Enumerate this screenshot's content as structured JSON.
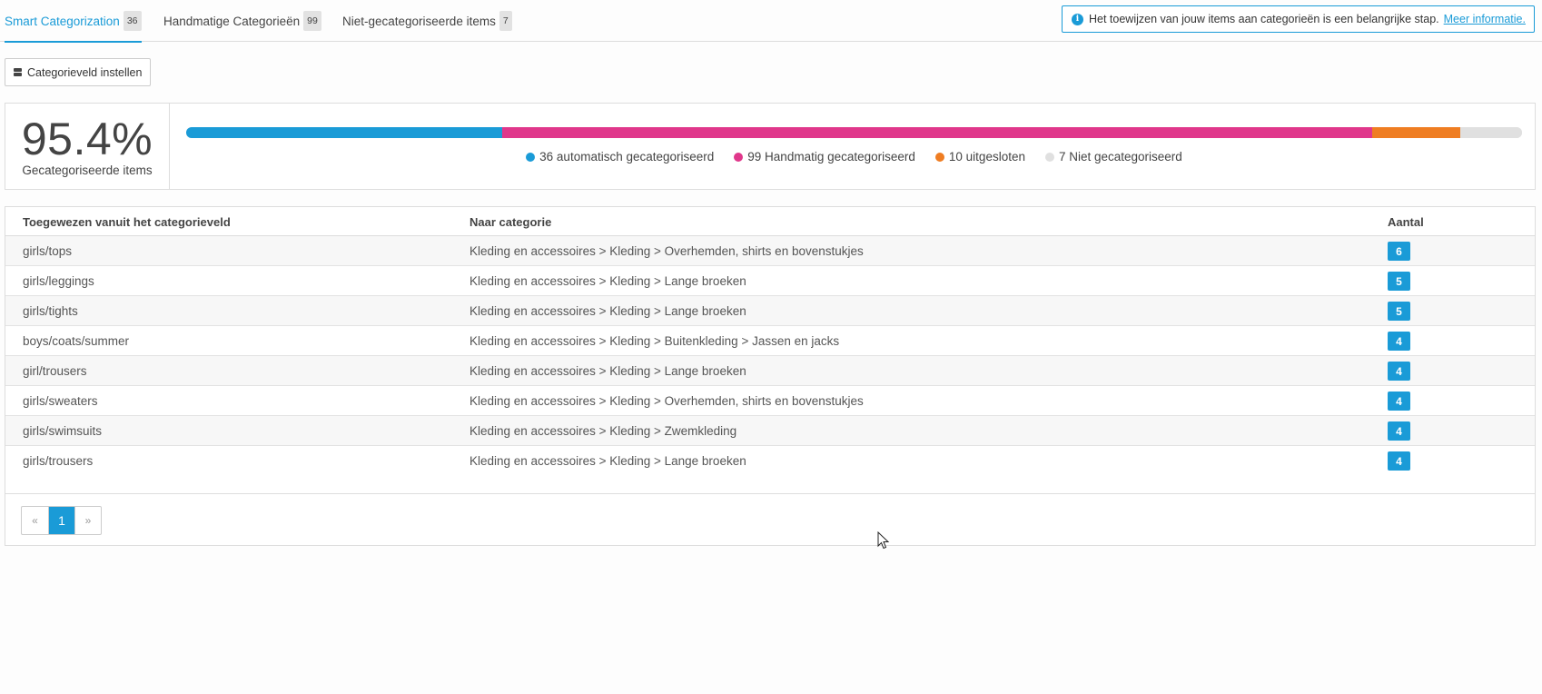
{
  "tabs": [
    {
      "label": "Smart Categorization",
      "count": "36",
      "active": true
    },
    {
      "label": "Handmatige Categorieën",
      "count": "99",
      "active": false
    },
    {
      "label": "Niet-gecategoriseerde items",
      "count": "7",
      "active": false
    }
  ],
  "info": {
    "text": "Het toewijzen van jouw items aan categorieën is een belangrijke stap.",
    "link": "Meer informatie."
  },
  "setup_button": {
    "label": "Categorieveld instellen",
    "icon": "list-icon"
  },
  "stats": {
    "percentage": "95.4%",
    "label": "Gecategoriseerde items",
    "segments": [
      {
        "legend": "36 automatisch gecategoriseerd",
        "value": 36,
        "color": "#1a9bd7"
      },
      {
        "legend": "99 Handmatig gecategoriseerd",
        "value": 99,
        "color": "#e0378b"
      },
      {
        "legend": "10 uitgesloten",
        "value": 10,
        "color": "#ef7d22"
      },
      {
        "legend": "7 Niet gecategoriseerd",
        "value": 7,
        "color": "#e0e0e0"
      }
    ]
  },
  "table": {
    "headers": {
      "field": "Toegewezen vanuit het categorieveld",
      "category": "Naar categorie",
      "count": "Aantal"
    },
    "rows": [
      {
        "field": "girls/tops",
        "category": "Kleding en accessoires > Kleding > Overhemden, shirts en bovenstukjes",
        "count": "6"
      },
      {
        "field": "girls/leggings",
        "category": "Kleding en accessoires > Kleding > Lange broeken",
        "count": "5"
      },
      {
        "field": "girls/tights",
        "category": "Kleding en accessoires > Kleding > Lange broeken",
        "count": "5"
      },
      {
        "field": "boys/coats/summer",
        "category": "Kleding en accessoires > Kleding > Buitenkleding > Jassen en jacks",
        "count": "4"
      },
      {
        "field": "girl/trousers",
        "category": "Kleding en accessoires > Kleding > Lange broeken",
        "count": "4"
      },
      {
        "field": "girls/sweaters",
        "category": "Kleding en accessoires > Kleding > Overhemden, shirts en bovenstukjes",
        "count": "4"
      },
      {
        "field": "girls/swimsuits",
        "category": "Kleding en accessoires > Kleding > Zwemkleding",
        "count": "4"
      },
      {
        "field": "girls/trousers",
        "category": "Kleding en accessoires > Kleding > Lange broeken",
        "count": "4"
      }
    ]
  },
  "pagination": {
    "prev": "«",
    "current": "1",
    "next": "»"
  }
}
